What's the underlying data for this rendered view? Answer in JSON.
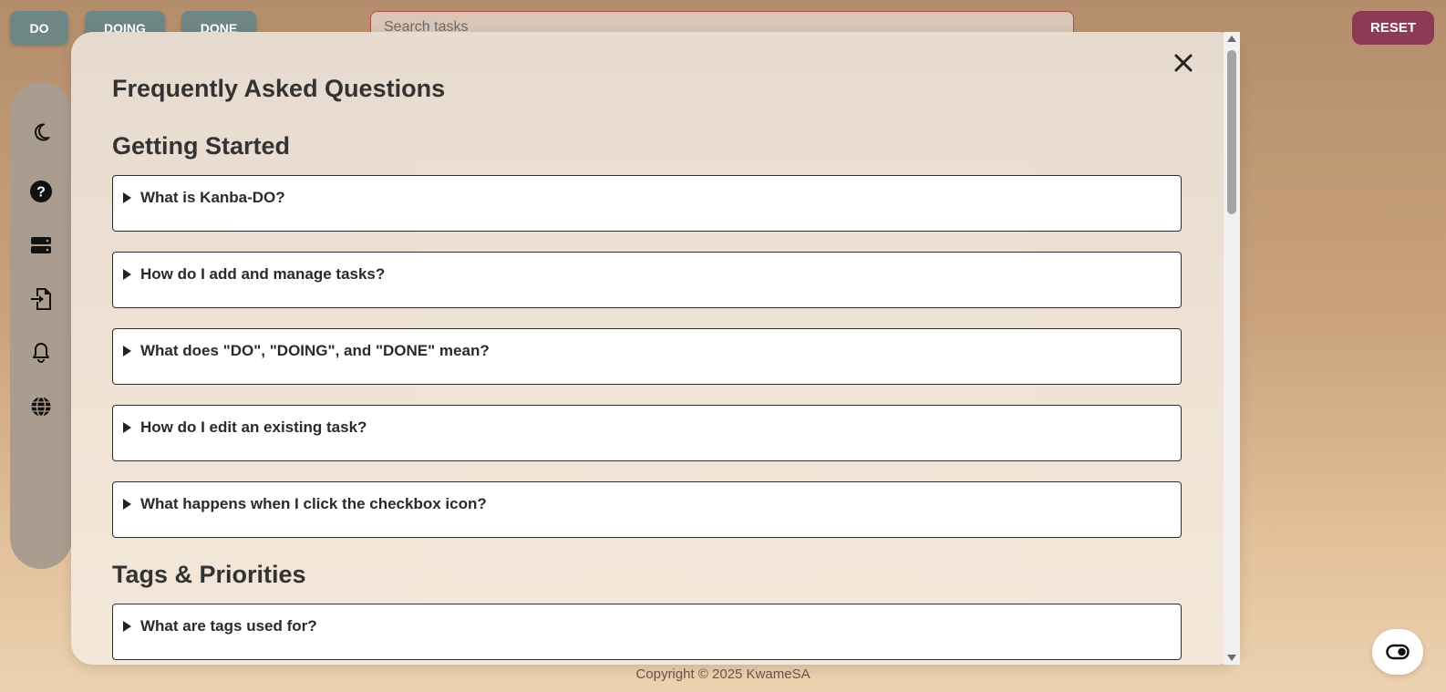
{
  "topbar": {
    "do_label": "DO",
    "doing_label": "DOING",
    "done_label": "DONE",
    "search_placeholder": "Search tasks",
    "reset_label": "RESET"
  },
  "sidebar": {
    "icons": [
      "moon-icon",
      "help-icon",
      "server-icon",
      "file-import-icon",
      "bell-icon",
      "globe-icon"
    ]
  },
  "faq_modal": {
    "title": "Frequently Asked Questions",
    "sections": [
      {
        "heading": "Getting Started",
        "questions": [
          "What is Kanba-DO?",
          "How do I add and manage tasks?",
          "What does \"DO\", \"DOING\", and \"DONE\" mean?",
          "How do I edit an existing task?",
          "What happens when I click the checkbox icon?"
        ]
      },
      {
        "heading": "Tags & Priorities",
        "questions": [
          "What are tags used for?"
        ]
      }
    ]
  },
  "footer": {
    "copyright": "Copyright © 2025 KwameSA"
  },
  "colors": {
    "tab_button": "#6e8785",
    "reset_button": "#8d3a56",
    "sidebar": "#aa9d90"
  }
}
